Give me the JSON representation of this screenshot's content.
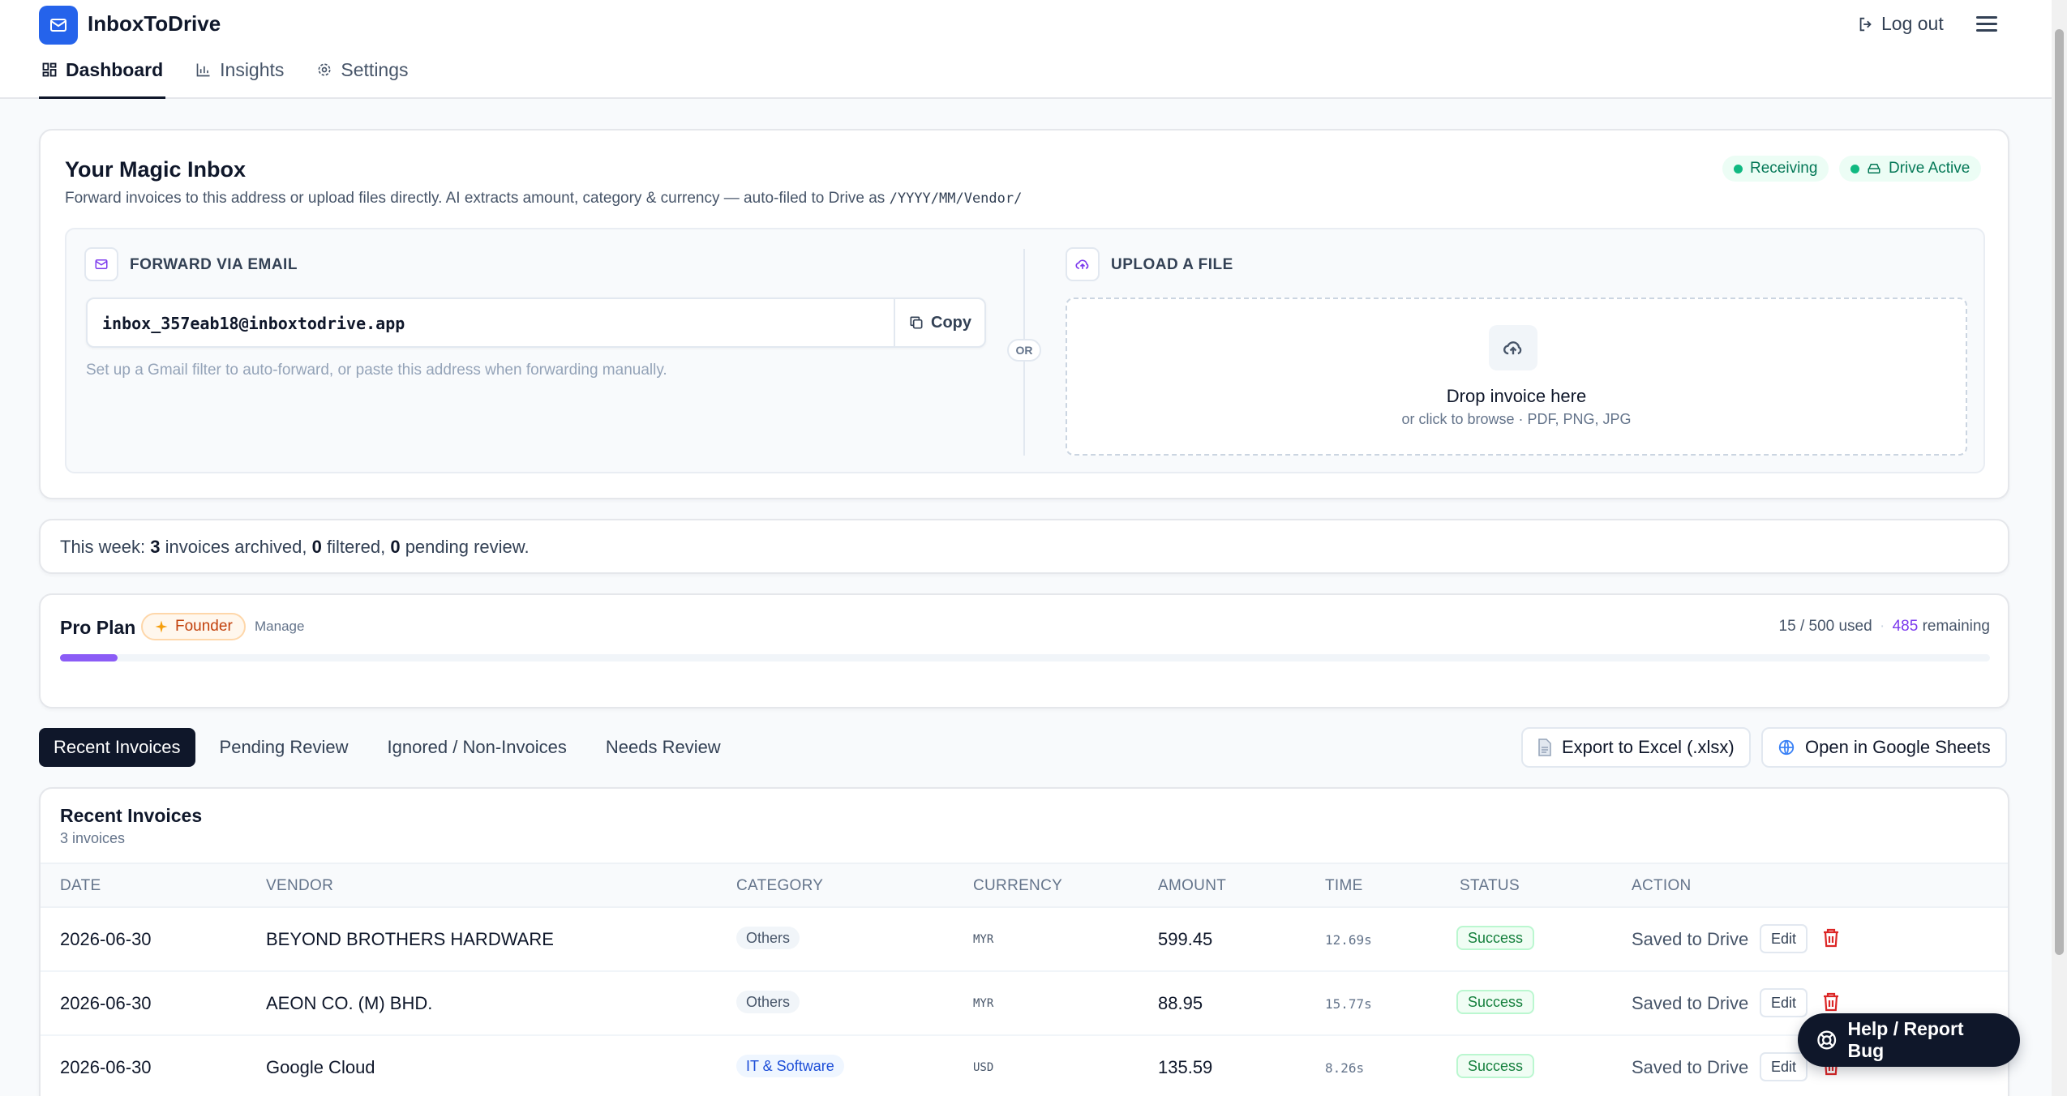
{
  "app": {
    "title": "InboxToDrive",
    "logout_label": "Log out"
  },
  "nav": [
    {
      "label": "Dashboard",
      "icon": "dashboard-icon",
      "active": true
    },
    {
      "label": "Insights",
      "icon": "bar-chart-icon",
      "active": false
    },
    {
      "label": "Settings",
      "icon": "gear-icon",
      "active": false
    }
  ],
  "magic_inbox": {
    "title": "Your Magic Inbox",
    "subtitle": "Forward invoices to this address or upload files directly. AI extracts amount, category & currency — auto-filed to Drive as",
    "path": "/YYYY/MM/Vendor/",
    "status_receiving": "Receiving",
    "status_drive": "Drive Active",
    "forward_label": "FORWARD VIA EMAIL",
    "email": "inbox_357eab18@inboxtodrive.app",
    "copy_label": "Copy",
    "hint": "Set up a Gmail filter to auto-forward, or paste this address when forwarding manually.",
    "or_label": "OR",
    "upload_label": "UPLOAD A FILE",
    "drop_title": "Drop invoice here",
    "drop_sub": "or click to browse · PDF, PNG, JPG"
  },
  "week": {
    "prefix": "This week:",
    "archived": "3",
    "archived_label": "invoices archived,",
    "filtered": "0",
    "filtered_label": "filtered,",
    "pending": "0",
    "pending_label": "pending review."
  },
  "plan": {
    "title": "Pro Plan",
    "badge": "Founder",
    "manage_label": "Manage",
    "used_text": "15 / 500 used",
    "separator": "·",
    "remaining": "485",
    "remaining_label": "remaining",
    "used_fraction": 0.03
  },
  "tabs": [
    "Recent Invoices",
    "Pending Review",
    "Ignored / Non-Invoices",
    "Needs Review"
  ],
  "actions": {
    "export_label": "Export to Excel (.xlsx)",
    "sheets_label": "Open in Google Sheets"
  },
  "table": {
    "title": "Recent Invoices",
    "count": "3 invoices",
    "columns": [
      "DATE",
      "VENDOR",
      "CATEGORY",
      "CURRENCY",
      "AMOUNT",
      "TIME",
      "STATUS",
      "ACTION"
    ],
    "rows": [
      {
        "date": "2026-06-30",
        "vendor": "BEYOND BROTHERS HARDWARE",
        "category": "Others",
        "currency": "MYR",
        "amount": "599.45",
        "time": "12.69s",
        "status": "Success",
        "action": "Saved to Drive",
        "edit": "Edit"
      },
      {
        "date": "2026-06-30",
        "vendor": "AEON CO. (M) BHD.",
        "category": "Others",
        "currency": "MYR",
        "amount": "88.95",
        "time": "15.77s",
        "status": "Success",
        "action": "Saved to Drive",
        "edit": "Edit"
      },
      {
        "date": "2026-06-30",
        "vendor": "Google Cloud",
        "category": "IT & Software",
        "currency": "USD",
        "amount": "135.59",
        "time": "8.26s",
        "status": "Success",
        "action": "Saved to Drive",
        "edit": "Edit"
      }
    ]
  },
  "help_label": "Help / Report Bug",
  "colors": {
    "brand": "#2563eb",
    "accent": "#8b5cf6",
    "success": "#10b981",
    "danger": "#dc2626"
  }
}
